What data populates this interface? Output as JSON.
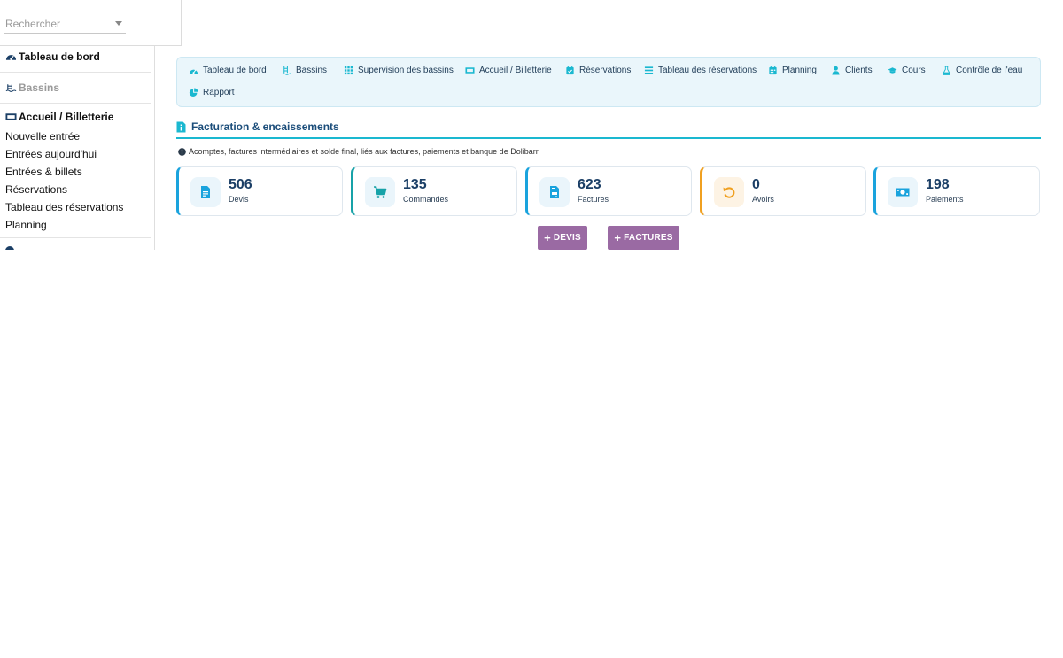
{
  "search": {
    "placeholder": "Rechercher"
  },
  "sidebar": {
    "dashboard": "Tableau de bord",
    "bassins": "Bassins",
    "accueil": "Accueil / Billetterie",
    "links": [
      "Nouvelle entrée",
      "Entrées aujourd'hui",
      "Entrées & billets",
      "Réservations",
      "Tableau des réservations",
      "Planning"
    ]
  },
  "topnav": {
    "items": [
      {
        "label": "Tableau de bord",
        "icon": "dashboard-icon"
      },
      {
        "label": "Bassins",
        "icon": "pool-icon"
      },
      {
        "label": "Supervision des bassins",
        "icon": "grid-icon"
      },
      {
        "label": "Accueil / Billetterie",
        "icon": "ticket-icon"
      },
      {
        "label": "Réservations",
        "icon": "calendar-check-icon"
      },
      {
        "label": "Tableau des réservations",
        "icon": "list-icon"
      },
      {
        "label": "Planning",
        "icon": "calendar-icon"
      },
      {
        "label": "Clients",
        "icon": "user-icon"
      },
      {
        "label": "Cours",
        "icon": "graduation-cap-icon"
      },
      {
        "label": "Contrôle de l'eau",
        "icon": "flask-icon"
      },
      {
        "label": "Rapport",
        "icon": "pie-chart-icon"
      }
    ]
  },
  "section": {
    "title": "Facturation & encaissements",
    "info": "Acomptes, factures intermédiaires et solde final, liés aux factures, paiements et banque de Dolibarr."
  },
  "cards": [
    {
      "value": "506",
      "label": "Devis",
      "icon": "document-icon",
      "color": "#1aa3dd"
    },
    {
      "value": "135",
      "label": "Commandes",
      "icon": "cart-icon",
      "color": "#17a2a8"
    },
    {
      "value": "623",
      "label": "Factures",
      "icon": "invoice-icon",
      "color": "#1aa3dd"
    },
    {
      "value": "0",
      "label": "Avoirs",
      "icon": "undo-icon",
      "color": "#f0a020"
    },
    {
      "value": "198",
      "label": "Paiements",
      "icon": "money-icon",
      "color": "#1aa3dd"
    }
  ],
  "buttons": {
    "devis": "DEVIS",
    "factures": "FACTURES"
  },
  "colors": {
    "accent": "#1ab8d0",
    "title": "#1b4d7a",
    "button": "#9a6aa3",
    "nav_bg": "#eaf6fb"
  }
}
